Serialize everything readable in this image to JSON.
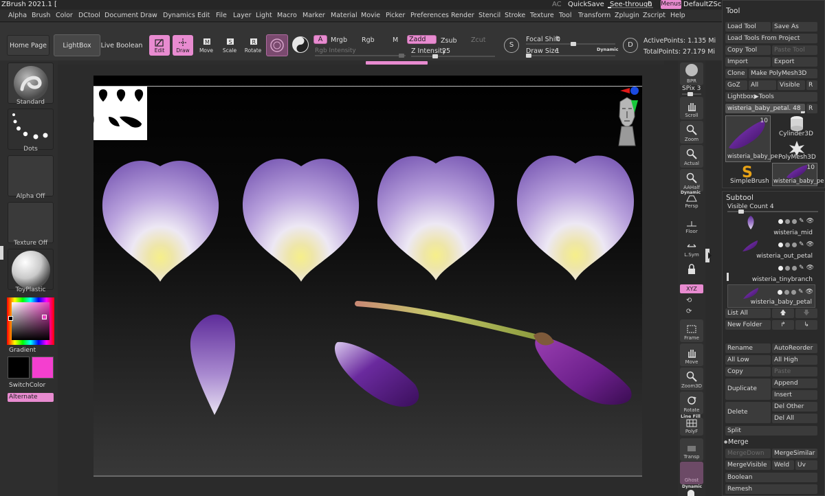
{
  "title": {
    "app": "ZBrush 2021.1 [",
    "ac": "AC",
    "quicksave": "QuickSave",
    "see_through_label": "See-through",
    "see_through_value": "0",
    "see_through_level": 0,
    "menus": "Menus",
    "script": "DefaultZScript"
  },
  "menubar": [
    "Alpha",
    "Brush",
    "Color",
    "DCtool",
    "Document",
    "Draw",
    "Dynamics",
    "Edit",
    "File",
    "Layer",
    "Light",
    "Macro",
    "Marker",
    "Material",
    "Movie",
    "Picker",
    "Preferences",
    "Render",
    "Stencil",
    "Stroke",
    "Texture",
    "Tool",
    "Transform",
    "Zplugin",
    "Zscript",
    "Help"
  ],
  "toolbar": {
    "home_page": "Home Page",
    "lightbox": "LightBox",
    "live_boolean": "Live Boolean",
    "edit": "Edit",
    "draw": "Draw",
    "move": "Move",
    "scale": "Scale",
    "rotate": "Rotate",
    "a": "A",
    "mrgb": "Mrgb",
    "rgb": "Rgb",
    "m": "M",
    "rgb_intensity": "Rgb Intensity",
    "zadd": "Zadd",
    "zsub": "Zsub",
    "zcut": "Zcut",
    "z_intensity_label": "Z Intensity",
    "z_intensity_value": "25",
    "z_intensity_level": 0.25,
    "s": "S",
    "focal_shift_label": "Focal Shift",
    "focal_shift_value": "0",
    "focal_shift_level": 0.5,
    "draw_size_label": "Draw Size",
    "draw_size_value": "1",
    "draw_size_level": 0.0,
    "dynamic": "Dynamic",
    "d": "D",
    "active_points": "ActivePoints: 1.135 Mi",
    "total_points": "TotalPoints: 27.179 Mi"
  },
  "left": {
    "brush": "Standard",
    "stroke": "Dots",
    "alpha": "Alpha Off",
    "texture": "Texture Off",
    "material": "ToyPlastic",
    "gradient": "Gradient",
    "switch_color": "SwitchColor",
    "alternate": "Alternate",
    "main_color": "#000000",
    "secondary_color": "#f43fcf"
  },
  "rstrip": {
    "bpr": "BPR",
    "spix_label": "SPix",
    "spix_value": "3",
    "scroll": "Scroll",
    "zoom": "Zoom",
    "actual": "Actual",
    "aahalf": "AAHalf",
    "dynamic": "Dynamic",
    "persp": "Persp",
    "floor": "Floor",
    "lsym": "L.Sym",
    "xyz": "XYZ",
    "frame": "Frame",
    "move": "Move",
    "zoom3d": "Zoom3D",
    "rotate": "Rotate",
    "linefill": "Line Fill",
    "polyf": "PolyF",
    "transp": "Transp",
    "ghost": "Ghost",
    "dynamic2": "Dynamic"
  },
  "tool": {
    "title": "Tool",
    "load_tool": "Load Tool",
    "save_as": "Save As",
    "load_from_project": "Load Tools From Project",
    "copy_tool": "Copy Tool",
    "paste_tool": "Paste Tool",
    "import": "Import",
    "export": "Export",
    "clone": "Clone",
    "make_polymesh": "Make PolyMesh3D",
    "goz": "GoZ",
    "all": "All",
    "visible": "Visible",
    "r": "R",
    "lightbox_tools": "Lightbox▶Tools",
    "current_tool_label": "wisteria_baby_petal.",
    "current_tool_value": "48",
    "r2": "R",
    "thumbs": [
      {
        "name": "wisteria_baby_pe",
        "count": "10"
      },
      {
        "name": "Cylinder3D",
        "count": ""
      },
      {
        "name": "PolyMesh3D",
        "count": ""
      },
      {
        "name": "SimpleBrush",
        "count": ""
      },
      {
        "name": "wisteria_baby_pe",
        "count": "10"
      }
    ]
  },
  "subtool": {
    "title": "Subtool",
    "visible_count": "Visible Count 4",
    "items": [
      {
        "name": "wisteria_mid"
      },
      {
        "name": "wisteria_out_petal"
      },
      {
        "name": "wisteria_tinybranch"
      },
      {
        "name": "wisteria_baby_petal"
      }
    ],
    "list_all": "List All",
    "new_folder": "New Folder",
    "rename": "Rename",
    "autoreorder": "AutoReorder",
    "all_low": "All Low",
    "all_high": "All High",
    "copy": "Copy",
    "paste": "Paste",
    "duplicate": "Duplicate",
    "append": "Append",
    "insert": "Insert",
    "delete": "Delete",
    "del_other": "Del Other",
    "del_all": "Del All",
    "split": "Split",
    "merge": "Merge",
    "merge_down": "MergeDown",
    "merge_similar": "MergeSimilar",
    "merge_visible": "MergeVisible",
    "weld": "Weld",
    "uv": "Uv",
    "boolean": "Boolean",
    "remesh": "Remesh"
  }
}
